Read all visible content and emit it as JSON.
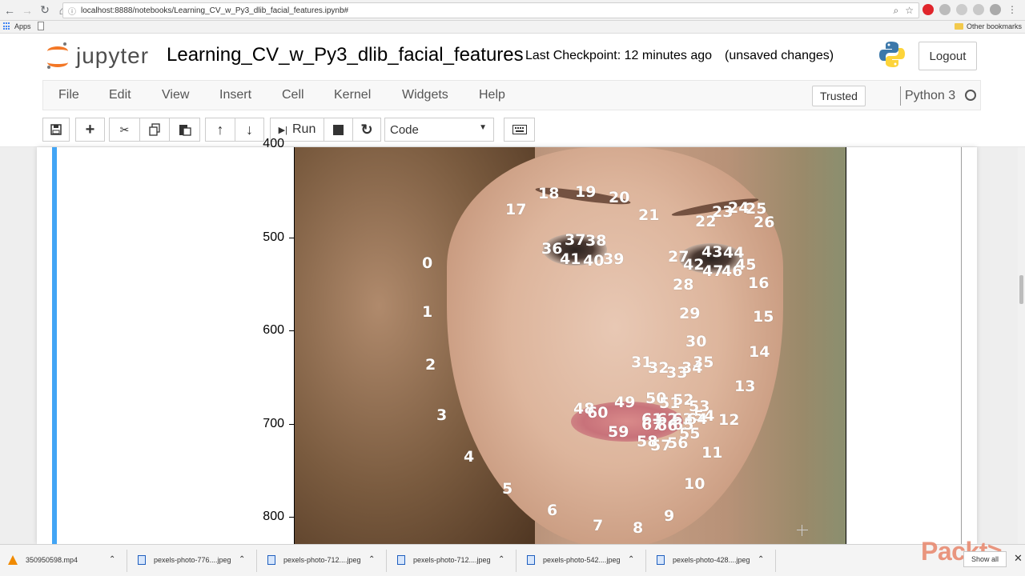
{
  "browser": {
    "url_info": "ⓘ",
    "url": "localhost:8888/notebooks/Learning_CV_w_Py3_dlib_facial_features.ipynb#",
    "bookmarks": {
      "apps": "Apps",
      "other": "Other bookmarks"
    }
  },
  "header": {
    "logo_text": "jupyter",
    "notebook_title": "Learning_CV_w_Py3_dlib_facial_features",
    "checkpoint": "Last Checkpoint: 12 minutes ago",
    "unsaved": "(unsaved changes)",
    "logout": "Logout"
  },
  "menubar": {
    "items": [
      "File",
      "Edit",
      "View",
      "Insert",
      "Cell",
      "Kernel",
      "Widgets",
      "Help"
    ],
    "trusted": "Trusted",
    "kernel_name": "Python 3"
  },
  "toolbar": {
    "run_label": "Run",
    "cell_type": "Code",
    "cell_type_arrow": "▼"
  },
  "plot": {
    "y_ticks": [
      "400",
      "500",
      "600",
      "700",
      "800"
    ],
    "landmarks": [
      {
        "label": "0"
      },
      {
        "label": "1"
      },
      {
        "label": "2"
      },
      {
        "label": "3"
      },
      {
        "label": "4"
      },
      {
        "label": "5"
      },
      {
        "label": "6"
      },
      {
        "label": "7"
      },
      {
        "label": "8"
      },
      {
        "label": "9"
      },
      {
        "label": "10"
      },
      {
        "label": "11"
      },
      {
        "label": "12"
      },
      {
        "label": "13"
      },
      {
        "label": "14"
      },
      {
        "label": "15"
      },
      {
        "label": "16"
      },
      {
        "label": "17"
      },
      {
        "label": "18"
      },
      {
        "label": "19"
      },
      {
        "label": "20"
      },
      {
        "label": "21"
      },
      {
        "label": "22"
      },
      {
        "label": "23"
      },
      {
        "label": "24"
      },
      {
        "label": "25"
      },
      {
        "label": "26"
      },
      {
        "label": "27"
      },
      {
        "label": "28"
      },
      {
        "label": "29"
      },
      {
        "label": "30"
      },
      {
        "label": "31"
      },
      {
        "label": "32"
      },
      {
        "label": "33"
      },
      {
        "label": "34"
      },
      {
        "label": "35"
      },
      {
        "label": "36"
      },
      {
        "label": "37"
      },
      {
        "label": "38"
      },
      {
        "label": "39"
      },
      {
        "label": "40"
      },
      {
        "label": "41"
      },
      {
        "label": "42"
      },
      {
        "label": "43"
      },
      {
        "label": "44"
      },
      {
        "label": "45"
      },
      {
        "label": "46"
      },
      {
        "label": "47"
      },
      {
        "label": "48"
      },
      {
        "label": "49"
      },
      {
        "label": "50"
      },
      {
        "label": "51"
      },
      {
        "label": "52"
      },
      {
        "label": "53"
      },
      {
        "label": "54"
      },
      {
        "label": "55"
      },
      {
        "label": "56"
      },
      {
        "label": "57"
      },
      {
        "label": "58"
      },
      {
        "label": "59"
      },
      {
        "label": "60"
      },
      {
        "label": "61"
      },
      {
        "label": "62"
      },
      {
        "label": "63"
      },
      {
        "label": "64"
      },
      {
        "label": "65"
      },
      {
        "label": "66"
      },
      {
        "label": "67"
      }
    ]
  },
  "downloads": {
    "items": [
      {
        "name": "350950598.mp4",
        "icon": "vlc-icon"
      },
      {
        "name": "pexels-photo-776....jpeg",
        "icon": "image-file-icon"
      },
      {
        "name": "pexels-photo-712....jpeg",
        "icon": "image-file-icon"
      },
      {
        "name": "pexels-photo-712....jpeg",
        "icon": "image-file-icon"
      },
      {
        "name": "pexels-photo-542....jpeg",
        "icon": "image-file-icon"
      },
      {
        "name": "pexels-photo-428....jpeg",
        "icon": "image-file-icon"
      }
    ],
    "show_all": "Show all",
    "watermark": "Packt>"
  },
  "colors": {
    "jupyter_orange": "#f37726",
    "cell_selected_rail": "#42a5f5",
    "landmark_text": "#ffffff"
  }
}
